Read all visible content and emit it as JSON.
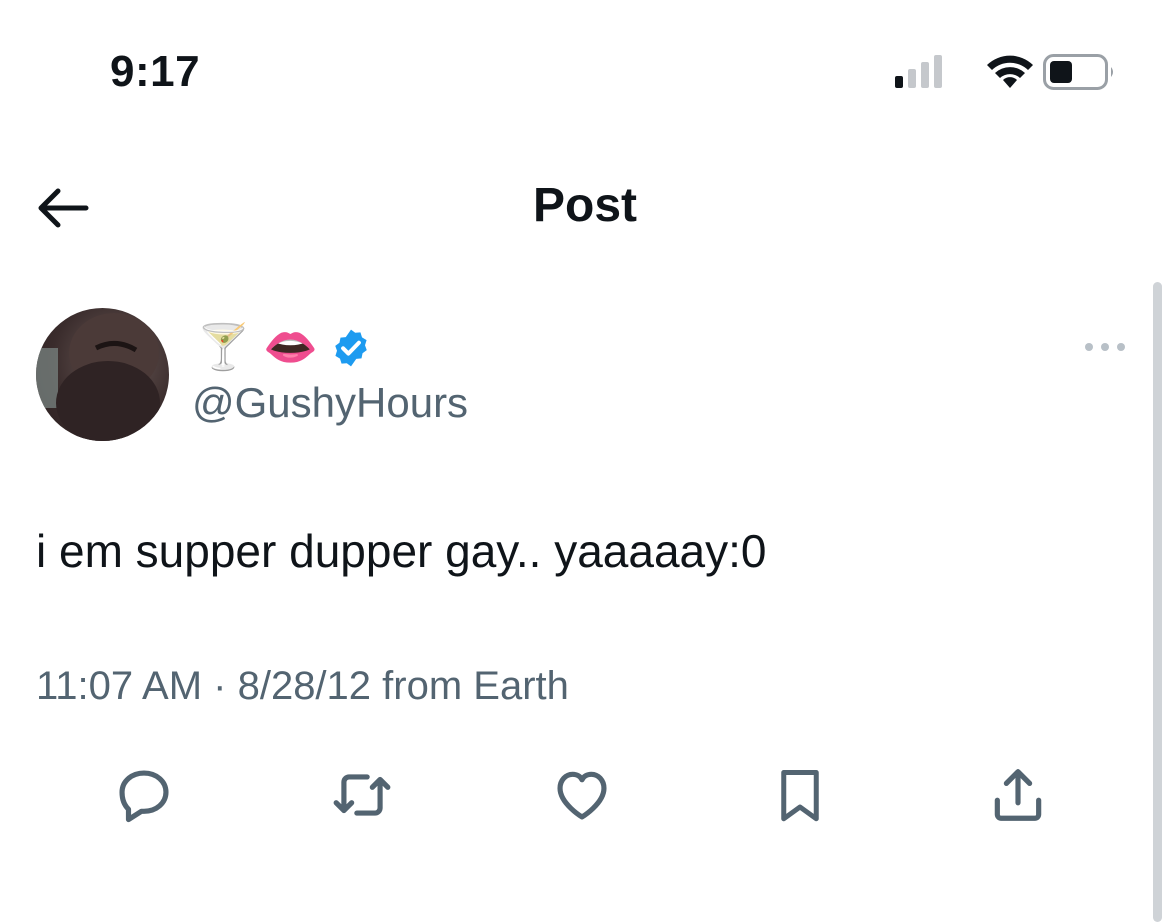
{
  "status_bar": {
    "time": "9:17",
    "icons": [
      "cellular-signal-icon",
      "wifi-icon",
      "battery-icon"
    ]
  },
  "header": {
    "title": "Post",
    "back_icon": "arrow-left-icon"
  },
  "post": {
    "display_name_emoji": "🍸 👄",
    "verified_icon": "verified-badge-icon",
    "handle": "@GushyHours",
    "text": "i em supper dupper gay.. yaaaaay:0",
    "timestamp": "11:07 AM · 8/28/12 from Earth",
    "more_icon": "more-horizontal-icon"
  },
  "actions": [
    {
      "name": "reply",
      "icon": "reply-icon"
    },
    {
      "name": "repost",
      "icon": "repost-icon"
    },
    {
      "name": "like",
      "icon": "heart-icon"
    },
    {
      "name": "bookmark",
      "icon": "bookmark-icon"
    },
    {
      "name": "share",
      "icon": "share-icon"
    }
  ],
  "colors": {
    "text_primary": "#0f1419",
    "text_secondary": "#536471",
    "verified_blue": "#1d9bf0",
    "background": "#ffffff"
  }
}
